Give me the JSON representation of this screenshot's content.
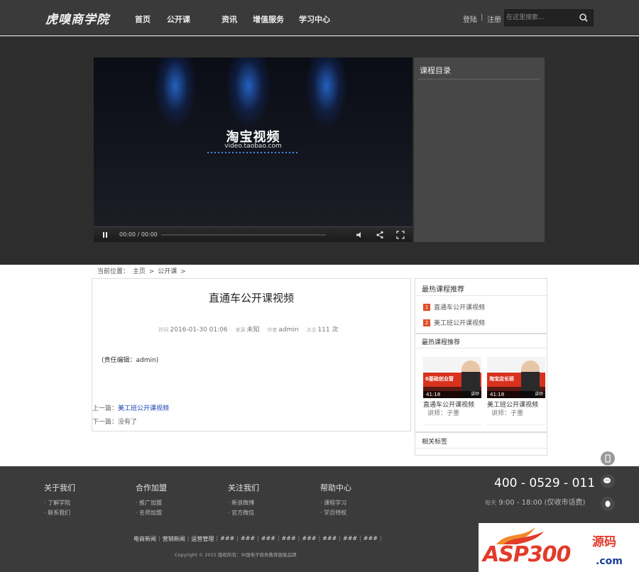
{
  "header": {
    "logo": "虎嗅商学院",
    "nav": [
      "首页",
      "公开课",
      "资讯",
      "增值服务",
      "学习中心"
    ],
    "login": "登陆",
    "auth_sep": "|",
    "register": "注册",
    "search_placeholder": "在这里搜索..."
  },
  "player": {
    "brand_cn": "淘宝视频",
    "brand_url": "video.taobao.com",
    "time": "00:00 / 00:00",
    "progress": 0
  },
  "catalog": {
    "title": "课程目录"
  },
  "breadcrumb": {
    "label": "当前位置：",
    "home": "主页",
    "sep1": ">",
    "section": "公开课",
    "sep2": ">"
  },
  "article": {
    "title": "直通车公开课视频",
    "meta": {
      "time_label": "时间",
      "time": "2016-01-30 01:06",
      "source_label": "来源",
      "source": "未知",
      "author_label": "作者",
      "author": "admin",
      "clicks_label": "点击",
      "clicks": "111 次"
    },
    "editor": "(责任编辑：admin)",
    "prev_label": "上一篇：",
    "prev_link": "美工班公开课视频",
    "next_label": "下一篇：",
    "next_text": "没有了"
  },
  "sidebar": {
    "hot_title": "最热课程推荐",
    "hot_items": [
      {
        "num": "1",
        "title": "直通车公开课视频"
      },
      {
        "num": "2",
        "title": "美工班公开课视频"
      }
    ],
    "hot2_title": "最热课程推荐",
    "courses": [
      {
        "thumb_text": "0基础创业营",
        "duration": "41:18",
        "teacher_tag": "讲师",
        "name": "直通车公开课视频",
        "teacher": "讲师：子墨"
      },
      {
        "thumb_text": "淘宝店长班",
        "duration": "41:18",
        "teacher_tag": "讲师",
        "name": "美工班公开课视频",
        "teacher": "讲师：子墨"
      }
    ],
    "tags_title": "相关标签"
  },
  "footer": {
    "columns": [
      {
        "title": "关于我们",
        "links": [
          "· 了解学院",
          "· 联系我们"
        ]
      },
      {
        "title": "合作加盟",
        "links": [
          "· 推广加盟",
          "· 名师加盟"
        ]
      },
      {
        "title": "关注我们",
        "links": [
          "· 新浪微博",
          "· 官方微信"
        ]
      },
      {
        "title": "帮助中心",
        "links": [
          "· 课程学习",
          "· 学员特权"
        ]
      }
    ],
    "phone": "400 - 0529 - 011",
    "hours_label": "每天",
    "hours": "9:00 - 18:00 (仅收市话费)",
    "bottom_links": [
      "电商新闻",
      "营销新闻",
      "运营管理",
      "###",
      "###",
      "###",
      "###",
      "###",
      "###",
      "###",
      "###"
    ],
    "copyright": "Copyright © 2015 版权所有：中国电子商务教育旗舰品牌"
  },
  "watermark": {
    "asp": "ASP300",
    "cn": "源码",
    "com": ".com"
  },
  "colors": {
    "accent_blue": "#3b86ff",
    "rank_red": "#e04e2a",
    "link_blue": "#1b40b8",
    "header_bg": "#3a3a3a",
    "footer_bg": "#3b3b3b"
  }
}
